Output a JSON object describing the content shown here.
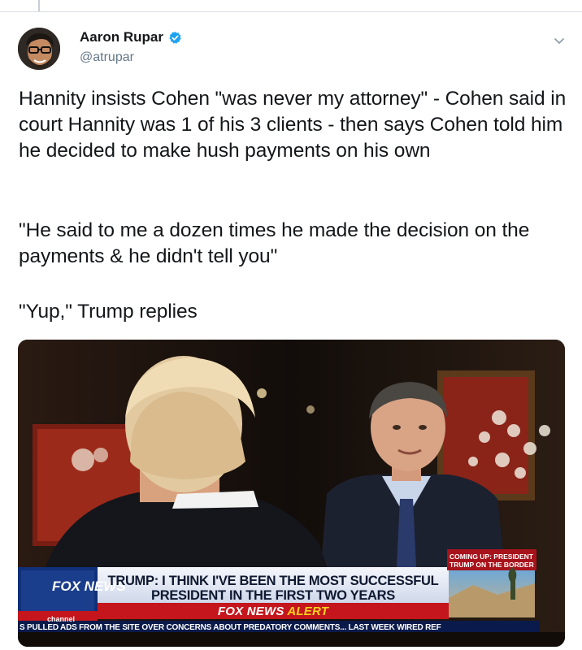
{
  "author": {
    "name": "Aaron Rupar",
    "handle": "@atrupar",
    "verified": true
  },
  "tweet": {
    "paragraphs": [
      "Hannity insists Cohen \"was never my attorney\" - Cohen said in court Hannity was 1 of his 3 clients - then says Cohen told him he decided to make hush payments on his own",
      "\"He said to me a dozen times he made the decision on the payments & he didn't tell you\"",
      "\"Yup,\" Trump replies"
    ]
  },
  "media": {
    "type": "video-still",
    "chyron": {
      "headline": "TRUMP: I THINK I'VE BEEN THE MOST SUCCESSFUL PRESIDENT IN THE FIRST TWO YEARS",
      "alert_prefix": "FOX NEWS",
      "alert_suffix": "ALERT",
      "coming_up": "COMING UP: PRESIDENT TRUMP ON THE BORDER",
      "ticker": "S PULLED ADS FROM THE SITE OVER CONCERNS ABOUT PREDATORY COMMENTS... LAST WEEK WIRED REF",
      "logo_word": "FOX NEWS",
      "channel": "channel"
    }
  },
  "colors": {
    "verified": "#1da1f2",
    "text": "#14171a",
    "muted": "#657786",
    "chyron_blue": "#1a3e8c",
    "alert_red": "#c4161c"
  },
  "icons": [
    "verified-badge-icon",
    "chevron-down-icon"
  ]
}
